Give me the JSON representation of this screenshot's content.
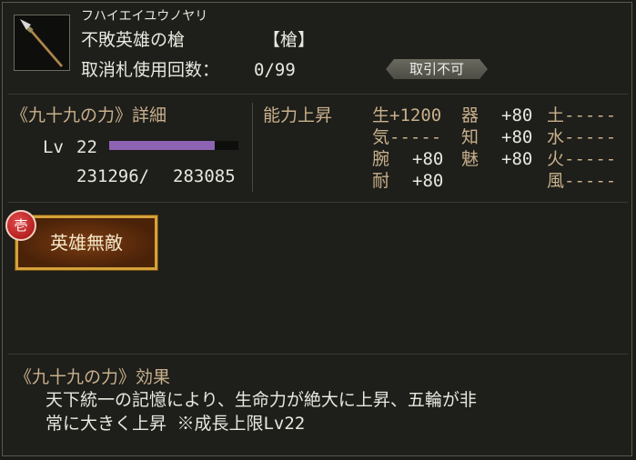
{
  "item": {
    "reading": "フハイエイユウノヤリ",
    "name": "不敗英雄の槍",
    "type": "【槍】",
    "usage_label": "取消札使用回数：",
    "usage_value": "0/99",
    "badge": "取引不可",
    "icon": "spear-icon"
  },
  "detail": {
    "title": "《九十九の力》詳細",
    "level_label": "Lv",
    "level_value": "22",
    "exp_current": "231296/",
    "exp_max": "283085",
    "exp_fraction": 0.817,
    "exp_color": "#8d63b3"
  },
  "stats": {
    "title": "能力上昇",
    "rows": [
      [
        "生+1200",
        "器",
        "+80",
        "土-----"
      ],
      [
        "気-----",
        "知",
        "+80",
        "水-----"
      ],
      [
        "腕",
        "+80",
        "魅",
        "+80",
        "火-----"
      ],
      [
        "耐",
        "+80",
        "風-----"
      ]
    ],
    "sei": "生+1200",
    "ki_label": "器",
    "ki_value": "+80",
    "tsuchi": "土-----",
    "ki2": "気-----",
    "chi_label": "知",
    "chi_value": "+80",
    "mizu": "水-----",
    "ude_label": "腕",
    "ude_value": "+80",
    "mi_label": "魅",
    "mi_value": "+80",
    "hi": "火-----",
    "tai_label": "耐",
    "tai_value": "+80",
    "kaze": "風-----"
  },
  "skill": {
    "tag": "壱",
    "label": "英雄無敵"
  },
  "effect": {
    "title": "《九十九の力》効果",
    "line1": "天下統一の記憶により、生命力が絶大に上昇、五輪が非",
    "line2": "常に大きく上昇 ※成長上限Lv22"
  }
}
